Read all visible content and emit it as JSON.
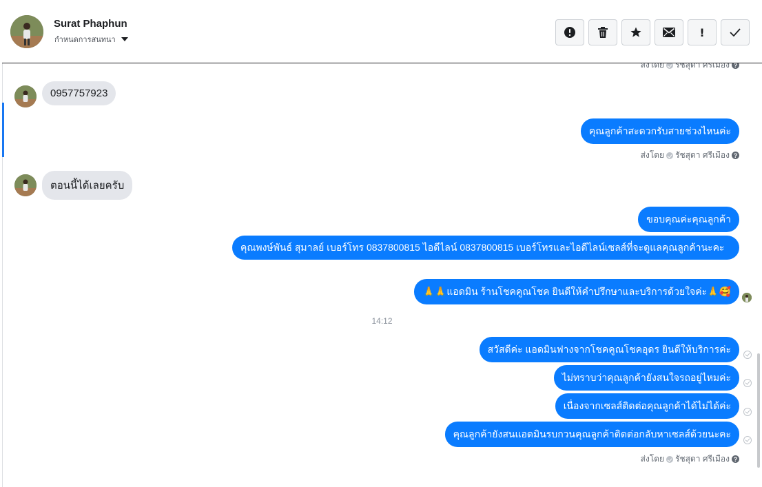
{
  "header": {
    "contact_name": "Surat Phaphun",
    "assign_label": "กำหนดการสนทนา",
    "actions": [
      {
        "name": "spam-button",
        "icon": "alert-circle-icon"
      },
      {
        "name": "delete-button",
        "icon": "trash-icon"
      },
      {
        "name": "star-button",
        "icon": "star-icon"
      },
      {
        "name": "mark-unread-button",
        "icon": "envelope-icon"
      },
      {
        "name": "follow-up-button",
        "icon": "exclamation-icon",
        "glyph": "!"
      },
      {
        "name": "mark-done-button",
        "icon": "check-icon"
      }
    ]
  },
  "messages": {
    "meta_prefix": "ส่งโดย",
    "meta_agent": "รัชสุดา ศรีเมือง",
    "help_glyph": "?",
    "incoming_1": "0957757923",
    "outgoing_1": "คุณลูกค้าสะดวกรับสายช่วงไหนค่ะ",
    "incoming_2": "ตอนนี้ได้เลยครับ",
    "outgoing_2": "ขอบคุณค่ะคุณลูกค้า",
    "outgoing_3": "คุณพงษ์พันธ์ สุมาลย์      เบอร์โทร 0837800815  ไอดีไลน์ 0837800815  เบอร์โทรและไอดีไลน์เซลส์ที่จะดูแลคุณลูกค้านะคะ",
    "outgoing_4": "🙏🙏แอดมิน ร้านโชคคูณโชค ยินดีให้คำปรึกษาและบริการด้วยใจค่ะ🙏🥰",
    "timestamp": "14:12",
    "outgoing_5": "สวัสดีค่ะ แอดมินฟางจากโชคคูณโชคอุดร ยินดีให้บริการค่ะ",
    "outgoing_6": "ไม่ทราบว่าคุณลูกค้ายังสนใจรถอยู่ไหมค่ะ",
    "outgoing_7": "เนื่องจากเซลส์ติดต่อคุณลูกค้าได้ไม่ได้ค่ะ",
    "outgoing_8": "คุณลูกค้ายังสนแอดมินรบกวนคุณลูกค้าติดต่อกลับหาเซลส์ด้วยนะคะ"
  },
  "colors": {
    "outgoing_bubble": "#0a7cff",
    "incoming_bubble": "#e4e6eb",
    "accent_bar": "#1877f2"
  }
}
